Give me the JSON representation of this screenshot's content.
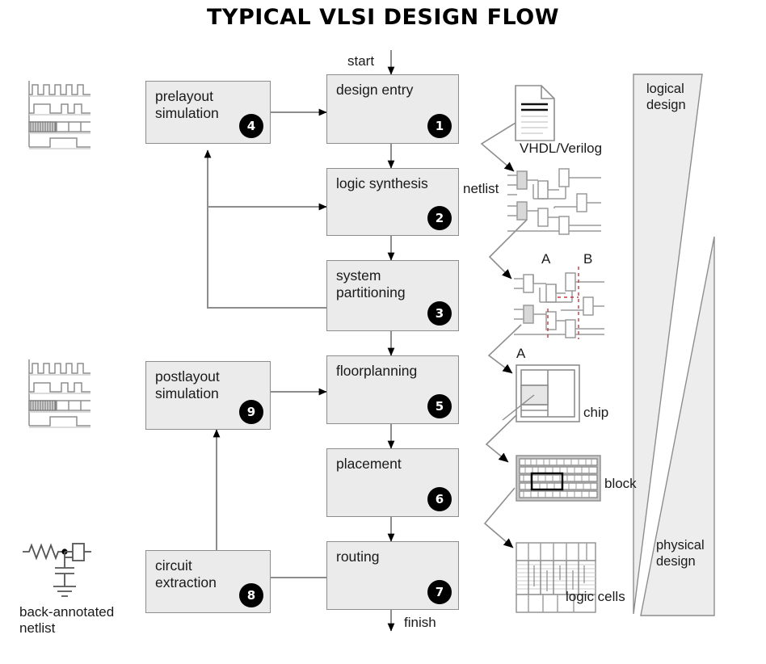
{
  "title": "TYPICAL VLSI DESIGN FLOW",
  "colors": {
    "box_fill": "#ebebeb",
    "box_stroke": "#8d8d8d",
    "badge_fill": "#000000",
    "badge_text": "#ffffff",
    "line": "#8d8d8d",
    "arrowhead": "#000000",
    "text": "#1a1a1a",
    "wedge_fill": "#ededed",
    "wedge_stroke": "#8d8d8d"
  },
  "flow": {
    "start_label": "start",
    "finish_label": "finish",
    "boxes": [
      {
        "id": "design-entry",
        "label": "design entry",
        "step": "1"
      },
      {
        "id": "logic-synthesis",
        "label": "logic synthesis",
        "step": "2"
      },
      {
        "id": "system-partitioning",
        "label": "system\npartitioning",
        "step": "3"
      },
      {
        "id": "prelayout-simulation",
        "label": "prelayout\nsimulation",
        "step": "4"
      },
      {
        "id": "floorplanning",
        "label": "floorplanning",
        "step": "5"
      },
      {
        "id": "placement",
        "label": "placement",
        "step": "6"
      },
      {
        "id": "routing",
        "label": "routing",
        "step": "7"
      },
      {
        "id": "circuit-extraction",
        "label": "circuit\nextraction",
        "step": "8"
      },
      {
        "id": "postlayout-simulation",
        "label": "postlayout\nsimulation",
        "step": "9"
      }
    ]
  },
  "illustrations": {
    "vhdl_verilog": "VHDL/Verilog",
    "netlist": "netlist",
    "partition_a": "A",
    "partition_b": "B",
    "chip_a": "A",
    "chip": "chip",
    "block": "block",
    "logic_cells": "logic cells",
    "back_annotated_netlist": "back-annotated\nnetlist"
  },
  "wedges": {
    "logical": "logical\ndesign",
    "physical": "physical\ndesign"
  },
  "icons": {
    "document": "document-icon",
    "waveform_top": "timing-waveform-icon",
    "waveform_bottom": "timing-waveform-icon",
    "netlist_gates": "netlist-gates-icon",
    "partitioned_netlist": "partitioned-netlist-icon",
    "chip_floorplan": "chip-floorplan-icon",
    "block_rows": "block-rows-icon",
    "logic_cells_rows": "logic-cells-icon",
    "rc_circuit": "rc-circuit-icon"
  }
}
